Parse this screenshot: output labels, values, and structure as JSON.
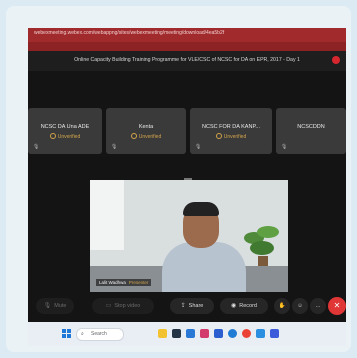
{
  "browser": {
    "url": "webexmeeting.webex.com/webappng/sites/webexmeeting/meeting/download/4ea5b2f",
    "tab_color": "#a12a2d"
  },
  "meeting": {
    "title": "Online Capacity Building Training Programme for VLE/CSC of NCSC for DA on EPR, 2017 - Day 1",
    "recording_indicator_color": "#d7262e"
  },
  "participants": [
    {
      "name": "NCSC DA Una ADE",
      "status": "Unverified"
    },
    {
      "name": "Kenta",
      "status": "Unverified"
    },
    {
      "name": "NCSC FOR DA KANP...",
      "status": "Unverified"
    },
    {
      "name": "NCSCDDN",
      "status": ""
    }
  ],
  "active_speaker": {
    "name": "Lalit Wadhwa",
    "role": "Presenter"
  },
  "controls": {
    "mute": "Mute",
    "stop_video": "Stop video",
    "share": "Share",
    "record": "Record",
    "more": "...",
    "end": "✕"
  },
  "taskbar": {
    "search_placeholder": "Search"
  }
}
